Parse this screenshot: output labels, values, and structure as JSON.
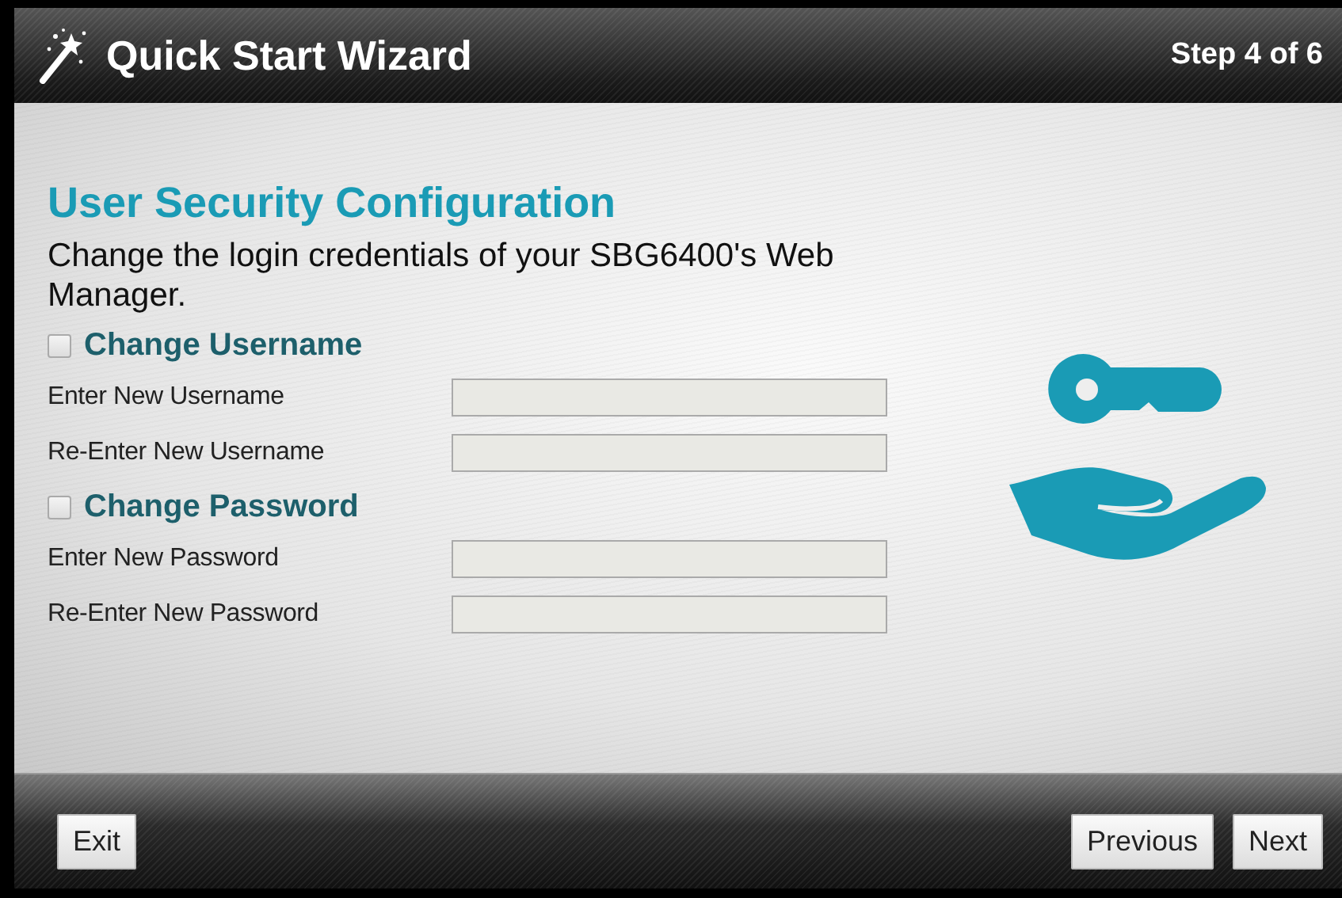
{
  "header": {
    "title": "Quick Start Wizard",
    "step": "Step 4 of 6"
  },
  "heading": "User Security Configuration",
  "description": "Change the login credentials of your SBG6400's Web Manager.",
  "sections": [
    {
      "label": "Change Username",
      "checked": false,
      "fields": [
        {
          "label": "Enter New Username"
        },
        {
          "label": "Re-Enter New Username"
        }
      ]
    },
    {
      "label": "Change Password",
      "checked": false,
      "fields": [
        {
          "label": "Enter New Password"
        },
        {
          "label": "Re-Enter New Password"
        }
      ]
    }
  ],
  "footer": {
    "buttons": [
      {
        "label": "Exit",
        "kind": "exit"
      },
      {
        "label": "Previous",
        "kind": "nav"
      },
      {
        "label": "Next",
        "kind": "nav"
      }
    ]
  }
}
